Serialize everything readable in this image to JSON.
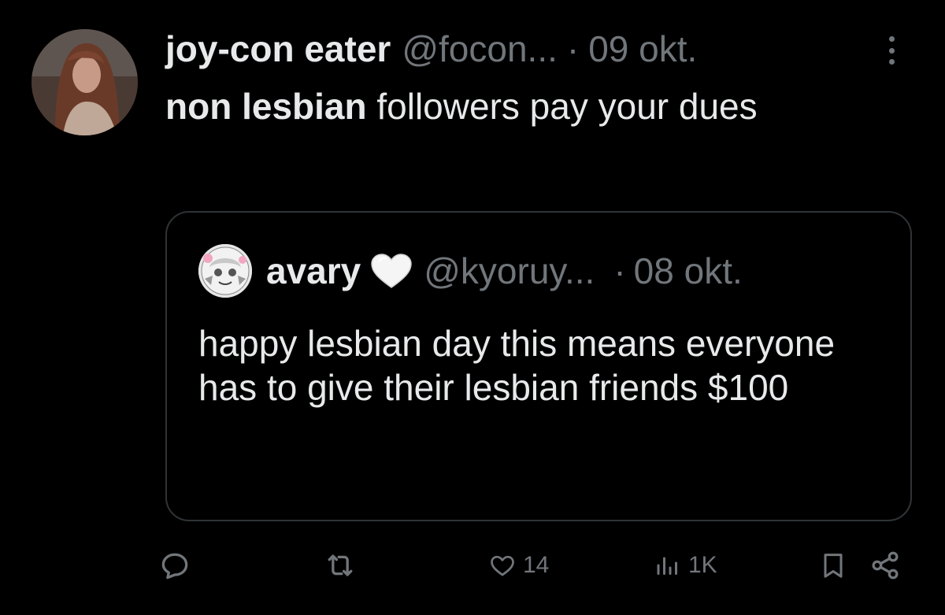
{
  "tweet": {
    "author": {
      "display_name": "joy-con eater",
      "handle": "@focon...",
      "avatar_icon": "profile-photo"
    },
    "separator": "·",
    "date": "09 okt.",
    "text_bold": "non lesbian",
    "text_rest": " followers pay your dues",
    "quote": {
      "display_name": "avary",
      "emoji": "white-heart",
      "handle": "@kyoruy...",
      "separator": "·",
      "date": "08 okt.",
      "text": "happy lesbian day this means everyone has to give their lesbian friends $100"
    },
    "actions": {
      "reply_icon": "reply-icon",
      "retweet_icon": "retweet-icon",
      "like_icon": "heart-icon",
      "like_count": "14",
      "views_icon": "views-icon",
      "views_count": "1K",
      "bookmark_icon": "bookmark-icon",
      "share_icon": "share-icon"
    },
    "colors": {
      "background": "#000000",
      "text_primary": "#e7e9ea",
      "text_secondary": "#71767b",
      "border": "#2f3336"
    }
  }
}
